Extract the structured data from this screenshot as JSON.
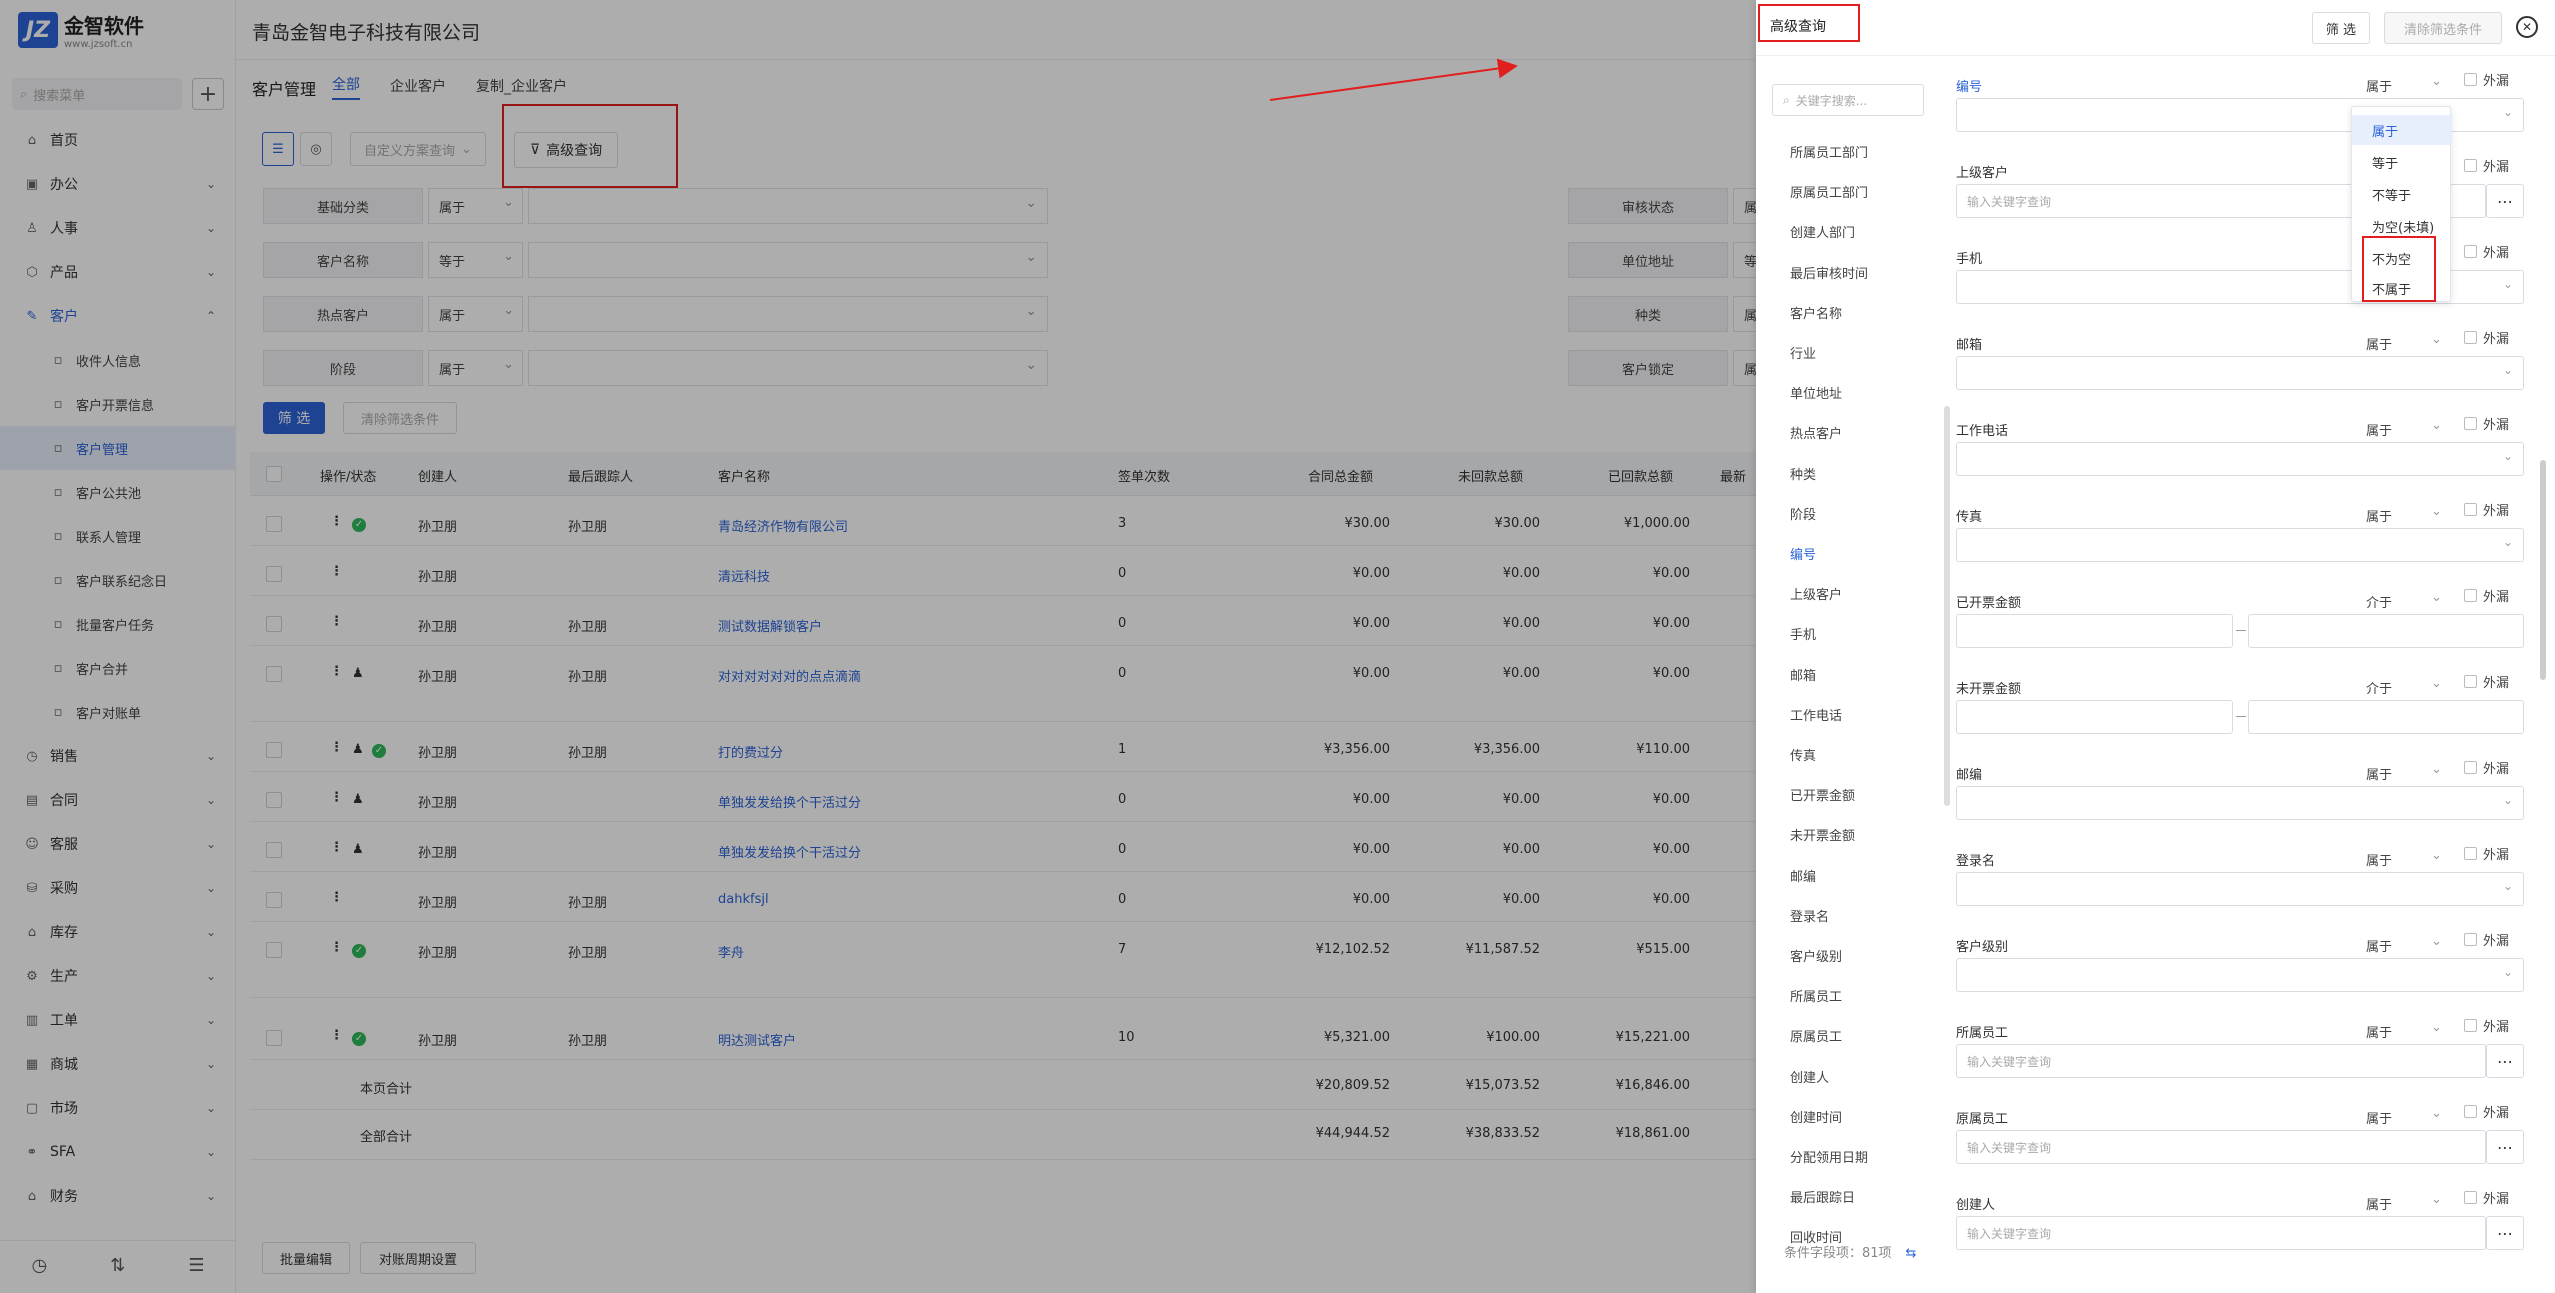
{
  "app": {
    "logo_mark": "JZ",
    "logo_name": "金智软件",
    "logo_url": "www.jzsoft.cn",
    "company": "青岛金智电子科技有限公司"
  },
  "sidebar": {
    "search_placeholder": "搜索菜单",
    "items": [
      {
        "icon": "home-icon",
        "glyph": "⌂",
        "label": "首页",
        "chev": ""
      },
      {
        "icon": "office-icon",
        "glyph": "▣",
        "label": "办公",
        "chev": "⌄"
      },
      {
        "icon": "people-icon",
        "glyph": "♙",
        "label": "人事",
        "chev": "⌄"
      },
      {
        "icon": "box-icon",
        "glyph": "⬡",
        "label": "产品",
        "chev": "⌄"
      },
      {
        "icon": "customer-icon",
        "glyph": "✎",
        "label": "客户",
        "chev": "⌃"
      }
    ],
    "sub_items": [
      "收件人信息",
      "客户开票信息",
      "客户管理",
      "客户公共池",
      "联系人管理",
      "客户联系纪念日",
      "批量客户任务",
      "客户合并",
      "客户对账单"
    ],
    "items2": [
      {
        "icon": "sales-icon",
        "glyph": "◷",
        "label": "销售"
      },
      {
        "icon": "contract-icon",
        "glyph": "▤",
        "label": "合同"
      },
      {
        "icon": "service-icon",
        "glyph": "☺",
        "label": "客服"
      },
      {
        "icon": "purchase-icon",
        "glyph": "⛁",
        "label": "采购"
      },
      {
        "icon": "stock-icon",
        "glyph": "⌂",
        "label": "库存"
      },
      {
        "icon": "production-icon",
        "glyph": "⚙",
        "label": "生产"
      },
      {
        "icon": "workorder-icon",
        "glyph": "▥",
        "label": "工单"
      },
      {
        "icon": "mall-icon",
        "glyph": "▦",
        "label": "商城"
      },
      {
        "icon": "market-icon",
        "glyph": "▢",
        "label": "市场"
      },
      {
        "icon": "sfa-icon",
        "glyph": "⚭",
        "label": "SFA"
      },
      {
        "icon": "finance-icon",
        "glyph": "⌂",
        "label": "财务"
      }
    ],
    "bottom": [
      "◷",
      "⇅",
      "☰"
    ]
  },
  "main": {
    "title": "客户管理",
    "tabs": [
      "全部",
      "企业客户",
      "复制_企业客户"
    ],
    "scheme_placeholder": "自定义方案查询",
    "adv_query": "高级查询",
    "filters": [
      {
        "label": "基础分类",
        "op": "属于",
        "label2": "审核状态",
        "op2": "属于"
      },
      {
        "label": "客户名称",
        "op": "等于",
        "label2": "单位地址",
        "op2": "等于"
      },
      {
        "label": "热点客户",
        "op": "属于",
        "label2": "种类",
        "op2": "属于"
      },
      {
        "label": "阶段",
        "op": "属于",
        "label2": "客户锁定",
        "op2": "属于"
      }
    ],
    "filter_btn": "筛 选",
    "clear_btn": "清除筛选条件",
    "headers": [
      "操作/状态",
      "创建人",
      "最后跟踪人",
      "客户名称",
      "签单次数",
      "合同总金额",
      "未回款总额",
      "已回款总额",
      "最新"
    ],
    "rows": [
      {
        "creator": "孙卫朋",
        "tracker": "孙卫朋",
        "name": "青岛经济作物有限公司",
        "count": "3",
        "total": "¥30.00",
        "unpaid": "¥30.00",
        "paid": "¥1,000.00",
        "ok": true,
        "usr": false
      },
      {
        "creator": "孙卫朋",
        "tracker": "",
        "name": "清远科技",
        "count": "0",
        "total": "¥0.00",
        "unpaid": "¥0.00",
        "paid": "¥0.00",
        "ok": false,
        "usr": false
      },
      {
        "creator": "孙卫朋",
        "tracker": "孙卫朋",
        "name": "测试数据解锁客户",
        "count": "0",
        "total": "¥0.00",
        "unpaid": "¥0.00",
        "paid": "¥0.00",
        "ok": false,
        "usr": false
      },
      {
        "creator": "孙卫朋",
        "tracker": "孙卫朋",
        "name": "对对对对对对的点点滴滴",
        "count": "0",
        "total": "¥0.00",
        "unpaid": "¥0.00",
        "paid": "¥0.00",
        "ok": false,
        "usr": true
      },
      {
        "creator": "孙卫朋",
        "tracker": "孙卫朋",
        "name": "打的费过分",
        "count": "1",
        "total": "¥3,356.00",
        "unpaid": "¥3,356.00",
        "paid": "¥110.00",
        "ok": true,
        "usr": true
      },
      {
        "creator": "孙卫朋",
        "tracker": "",
        "name": "单独发发给换个干活过分",
        "count": "0",
        "total": "¥0.00",
        "unpaid": "¥0.00",
        "paid": "¥0.00",
        "ok": false,
        "usr": true
      },
      {
        "creator": "孙卫朋",
        "tracker": "",
        "name": "单独发发给换个干活过分",
        "count": "0",
        "total": "¥0.00",
        "unpaid": "¥0.00",
        "paid": "¥0.00",
        "ok": false,
        "usr": true
      },
      {
        "creator": "孙卫朋",
        "tracker": "孙卫朋",
        "name": "dahkfsjl",
        "count": "0",
        "total": "¥0.00",
        "unpaid": "¥0.00",
        "paid": "¥0.00",
        "ok": false,
        "usr": false
      },
      {
        "creator": "孙卫朋",
        "tracker": "孙卫朋",
        "name": "李舟",
        "count": "7",
        "total": "¥12,102.52",
        "unpaid": "¥11,587.52",
        "paid": "¥515.00",
        "ok": true,
        "usr": false
      },
      {
        "creator": "孙卫朋",
        "tracker": "孙卫朋",
        "name": "明达测试客户",
        "count": "10",
        "total": "¥5,321.00",
        "unpaid": "¥100.00",
        "paid": "¥15,221.00",
        "ok": true,
        "usr": false
      }
    ],
    "page_total": {
      "label": "本页合计",
      "total": "¥20,809.52",
      "unpaid": "¥15,073.52",
      "paid": "¥16,846.00"
    },
    "all_total": {
      "label": "全部合计",
      "total": "¥44,944.52",
      "unpaid": "¥38,833.52",
      "paid": "¥18,861.00"
    },
    "footer_btns": [
      "批量编辑",
      "对账周期设置"
    ]
  },
  "panel": {
    "title": "高级查询",
    "filter_btn": "筛 选",
    "clear_btn": "清除筛选条件",
    "search_placeholder": "关键字搜索...",
    "field_list": [
      "所属员工部门",
      "原属员工部门",
      "创建人部门",
      "最后审核时间",
      "客户名称",
      "行业",
      "单位地址",
      "热点客户",
      "种类",
      "阶段",
      "编号",
      "上级客户",
      "手机",
      "邮箱",
      "工作电话",
      "传真",
      "已开票金额",
      "未开票金额",
      "邮编",
      "登录名",
      "客户级别",
      "所属员工",
      "原属员工",
      "创建人",
      "创建时间",
      "分配领用日期",
      "最后跟踪日",
      "回收时间"
    ],
    "count_text": "条件字段项：81项",
    "outside_label": "外漏",
    "input_placeholder": "输入关键字查询",
    "conditions": [
      {
        "name": "编号",
        "op": "属于",
        "kind": "sel"
      },
      {
        "name": "上级客户",
        "op": "",
        "kind": "pick"
      },
      {
        "name": "手机",
        "op": "",
        "kind": "sel"
      },
      {
        "name": "邮箱",
        "op": "属于",
        "kind": "sel"
      },
      {
        "name": "工作电话",
        "op": "属于",
        "kind": "sel"
      },
      {
        "name": "传真",
        "op": "属于",
        "kind": "sel"
      },
      {
        "name": "已开票金额",
        "op": "介于",
        "kind": "range"
      },
      {
        "name": "未开票金额",
        "op": "介于",
        "kind": "range"
      },
      {
        "name": "邮编",
        "op": "属于",
        "kind": "sel"
      },
      {
        "name": "登录名",
        "op": "属于",
        "kind": "sel"
      },
      {
        "name": "客户级别",
        "op": "属于",
        "kind": "sel"
      },
      {
        "name": "所属员工",
        "op": "属于",
        "kind": "pick"
      },
      {
        "name": "原属员工",
        "op": "属于",
        "kind": "pick"
      },
      {
        "name": "创建人",
        "op": "属于",
        "kind": "pick"
      }
    ],
    "dropdown": [
      "属于",
      "等于",
      "不等于",
      "为空(未填)",
      "不为空",
      "不属于"
    ]
  }
}
